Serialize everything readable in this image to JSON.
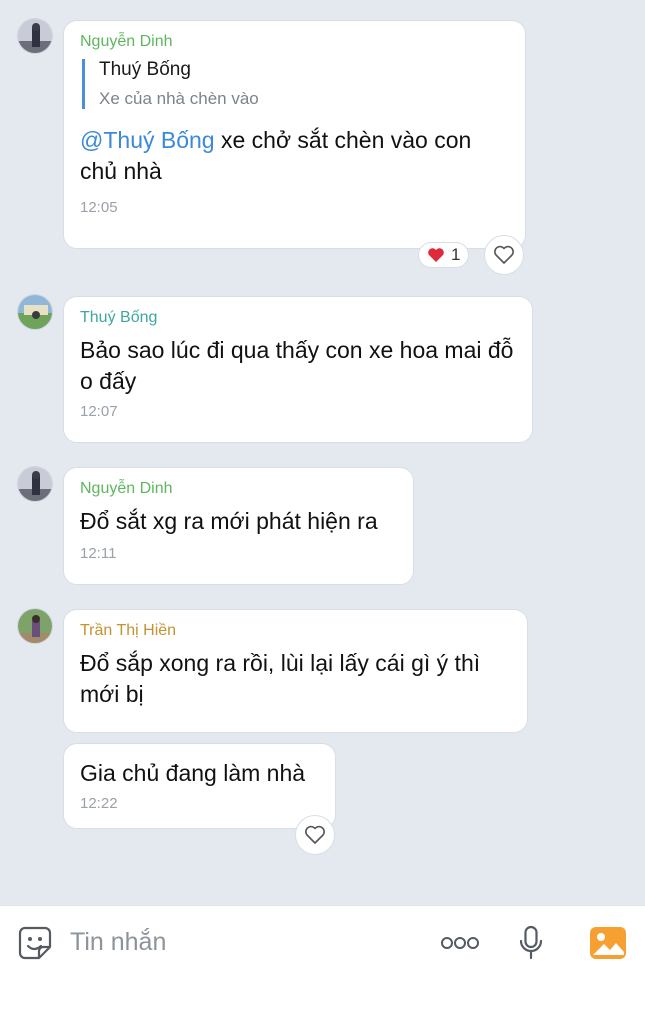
{
  "messages": [
    {
      "sender": "Nguyễn Dinh",
      "quote": {
        "name": "Thuý Bống",
        "text": "Xe của nhà chèn vào"
      },
      "mention": "@Thuý Bống",
      "text": " xe chở sắt chèn vào con chủ nhà",
      "time": "12:05",
      "reaction": {
        "emoji": "❤️",
        "count": "1"
      }
    },
    {
      "sender": "Thuý Bống",
      "text": "Bảo sao lúc đi qua thấy con xe hoa mai đỗ o đấy",
      "time": "12:07"
    },
    {
      "sender": "Nguyễn Dinh",
      "text": "Đổ sắt xg ra mới phát hiện ra",
      "time": "12:11"
    },
    {
      "sender": "Trần Thị Hiền",
      "text": "Đổ sắp xong ra rồi, lùi lại lấy cái gì ý thì mới bị"
    },
    {
      "text": "Gia chủ đang làm nhà",
      "time": "12:22"
    }
  ],
  "composer": {
    "placeholder": "Tin nhắn",
    "icons": [
      "sticker-icon",
      "more-icon",
      "microphone-icon",
      "image-icon"
    ]
  },
  "colors": {
    "background": "#e4e9ef",
    "accent": "#3a8ad8",
    "sender_green": "#5fb65f",
    "sender_teal": "#3fa7a0",
    "sender_orange": "#c4922f",
    "image_icon": "#f5a031"
  }
}
